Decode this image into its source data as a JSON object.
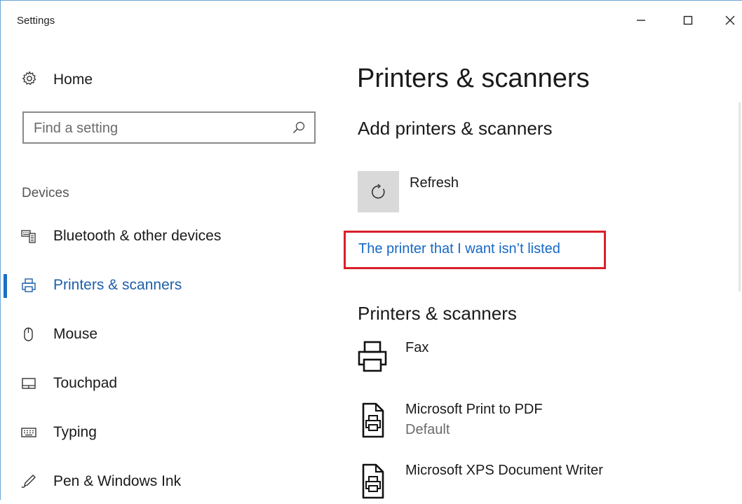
{
  "window": {
    "title": "Settings"
  },
  "sidebar": {
    "home_label": "Home",
    "search": {
      "placeholder": "Find a setting",
      "value": ""
    },
    "section_header": "Devices",
    "items": [
      {
        "label": "Bluetooth & other devices",
        "icon": "bluetooth-devices-icon",
        "active": false
      },
      {
        "label": "Printers & scanners",
        "icon": "printer-icon",
        "active": true
      },
      {
        "label": "Mouse",
        "icon": "mouse-icon",
        "active": false
      },
      {
        "label": "Touchpad",
        "icon": "touchpad-icon",
        "active": false
      },
      {
        "label": "Typing",
        "icon": "keyboard-icon",
        "active": false
      },
      {
        "label": "Pen & Windows Ink",
        "icon": "pen-icon",
        "active": false
      }
    ]
  },
  "main": {
    "title": "Printers & scanners",
    "add_section": {
      "heading": "Add printers & scanners",
      "refresh_label": "Refresh",
      "not_listed_link": "The printer that I want isn’t listed"
    },
    "devices_section": {
      "heading": "Printers & scanners",
      "devices": [
        {
          "name": "Fax",
          "status": "",
          "icon": "fax-printer-icon"
        },
        {
          "name": "Microsoft Print to PDF",
          "status": "Default",
          "icon": "document-printer-icon"
        },
        {
          "name": "Microsoft XPS Document Writer",
          "status": "",
          "icon": "document-printer-icon"
        }
      ]
    }
  },
  "colors": {
    "accent": "#1e6fc4",
    "link": "#1668c7",
    "highlight": "#d9202a",
    "tile": "#d9d9d9"
  }
}
